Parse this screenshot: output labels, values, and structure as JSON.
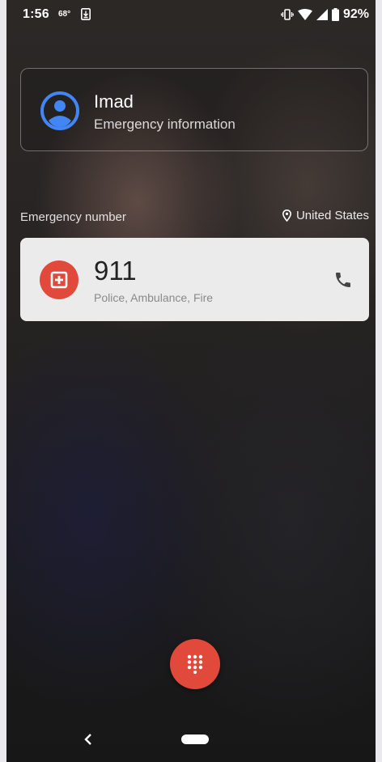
{
  "status_bar": {
    "time": "1:56",
    "temperature": "68°",
    "battery_percent": "92%",
    "icons": [
      "download-icon",
      "vibrate-icon",
      "wifi-icon",
      "signal-icon",
      "battery-icon"
    ]
  },
  "contact": {
    "name": "Imad",
    "subtitle": "Emergency information",
    "icon": "account-circle-icon"
  },
  "emergency": {
    "label": "Emergency number",
    "location": "United States",
    "location_icon": "location-pin-icon"
  },
  "number_card": {
    "number": "911",
    "services": "Police, Ambulance, Fire",
    "icon": "medical-plus-icon",
    "call_icon": "phone-icon"
  },
  "fab": {
    "icon": "dialpad-icon"
  },
  "navigation": {
    "back_icon": "back-icon",
    "home_icon": "home-pill-icon"
  },
  "colors": {
    "accent_red": "#e14a3b",
    "avatar_blue": "#4285f4",
    "card_bg": "#ebebeb"
  }
}
